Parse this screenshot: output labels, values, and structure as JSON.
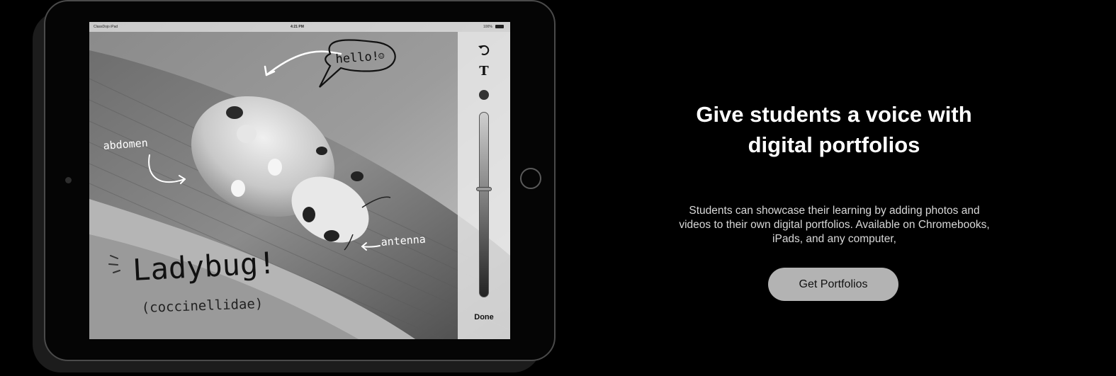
{
  "device": {
    "status_bar": {
      "carrier": "ClassDojo iPad",
      "time": "4:21 PM",
      "battery": "100%"
    },
    "annotations": {
      "hello": "hello!",
      "hello_face": "☺",
      "abdomen": "abdomen",
      "antenna": "antenna",
      "title": "Ladybug!",
      "subtitle": "(coccinellidae)"
    },
    "tools": {
      "undo_icon": "undo-icon",
      "text_tool": "T",
      "color_dot_color": "#333333",
      "done_label": "Done"
    }
  },
  "marketing": {
    "headline_line1": "Give students a voice with",
    "headline_line2": "digital portfolios",
    "description": "Students can showcase their learning by adding photos and videos to their own digital portfolios. Available on Chromebooks, iPads, and any computer,",
    "cta_label": "Get Portfolios"
  }
}
